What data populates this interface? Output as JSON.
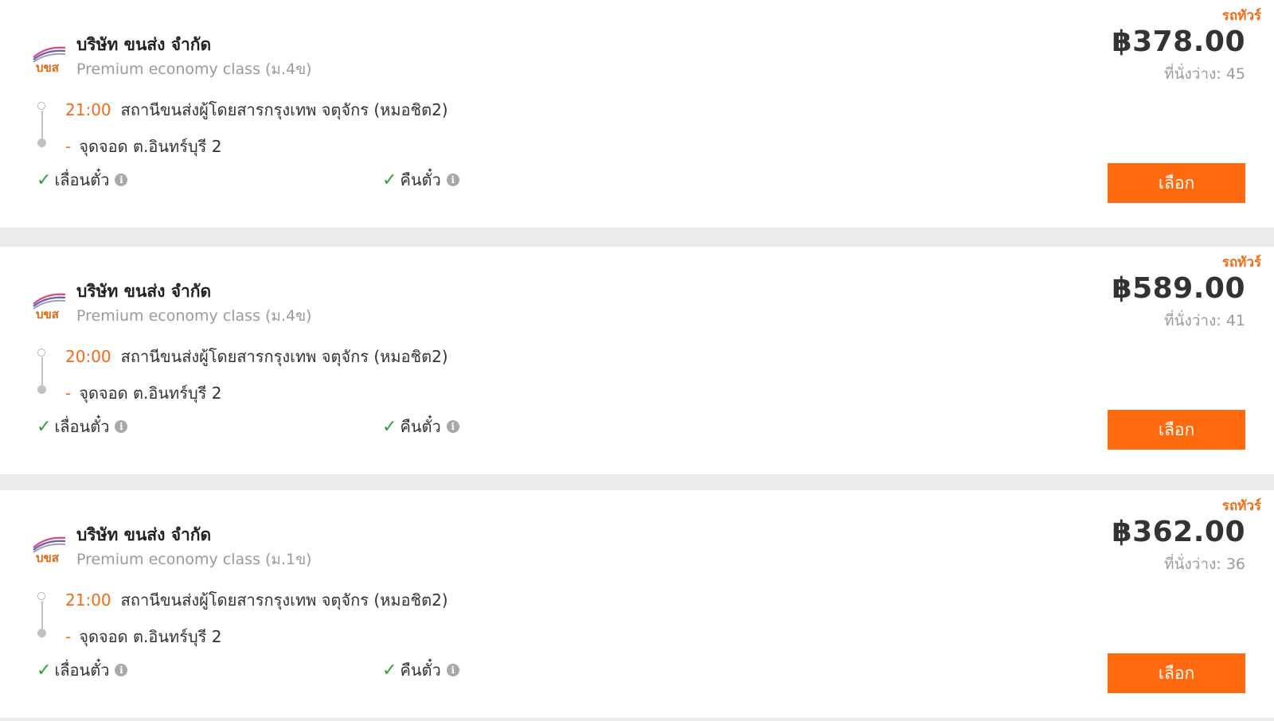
{
  "results": [
    {
      "tag": "รถทัวร์",
      "logo_text": "บขส",
      "company": "บริษัท ขนส่ง จำกัด",
      "class_name": "Premium economy class (ม.4ข)",
      "depart_time": "20:00",
      "depart_station": "สถานีขนส่งผู้โดยสารกรุงเทพ จตุจักร (หมอชิต2)",
      "stop_dash": "-",
      "stop": "จุดจอด ต.อินทร์บุรี 2",
      "policy_change": "เลื่อนตั๋ว",
      "policy_refund": "คืนตั๋ว",
      "price": "฿589.00",
      "seats": "ที่นั่งว่าง: 41",
      "select_label": "เลือก"
    },
    {
      "tag": "รถทัวร์",
      "logo_text": "บขส",
      "company": "บริษัท ขนส่ง จำกัด",
      "class_name": "Premium economy class (ม.1ข)",
      "depart_time": "21:00",
      "depart_station": "สถานีขนส่งผู้โดยสารกรุงเทพ จตุจักร (หมอชิต2)",
      "stop_dash": "-",
      "stop": "จุดจอด ต.อินทร์บุรี 2",
      "policy_change": "เลื่อนตั๋ว",
      "policy_refund": "คืนตั๋ว",
      "price": "฿362.00",
      "seats": "ที่นั่งว่าง: 36",
      "select_label": "เลือก"
    },
    {
      "tag": "รถทัวร์",
      "logo_text": "บขส",
      "company": "บริษัท ขนส่ง จำกัด",
      "class_name": "Premium economy class (ม.4ข)",
      "depart_time": "21:00",
      "depart_station": "สถานีขนส่งผู้โดยสารกรุงเทพ จตุจักร (หมอชิต2)",
      "stop_dash": "-",
      "stop": "จุดจอด ต.อินทร์บุรี 2",
      "policy_change": "เลื่อนตั๋ว",
      "policy_refund": "คืนตั๋ว",
      "price": "฿378.00",
      "seats": "ที่นั่งว่าง: 45",
      "select_label": "เลือก"
    }
  ],
  "icons": {
    "check": "check-icon",
    "info": "info-icon",
    "logo": "bus-company-logo"
  },
  "colors": {
    "accent": "#f26c16",
    "button": "#ff6a0e",
    "check": "#27a33b",
    "muted": "#9b9b9b"
  }
}
